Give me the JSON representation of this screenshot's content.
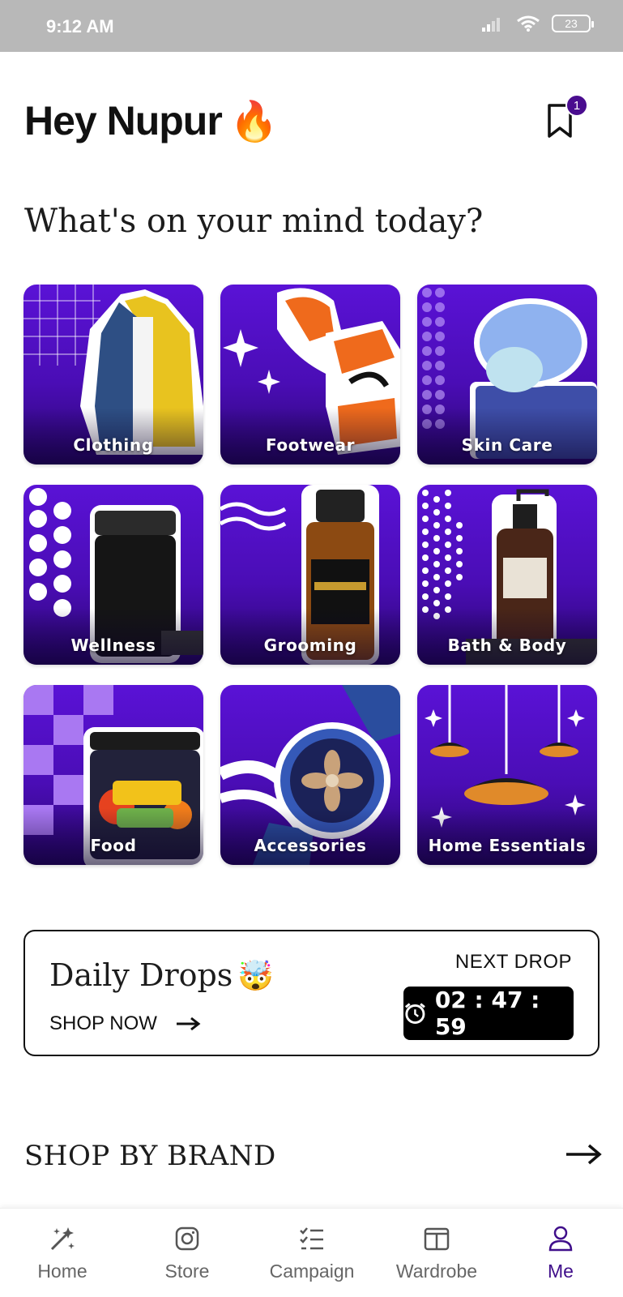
{
  "status_bar": {
    "time": "9:12 AM",
    "battery": "23",
    "icons": [
      "signal-icon",
      "wifi-icon",
      "battery-icon"
    ]
  },
  "header": {
    "greeting": "Hey Nupur",
    "greeting_emoji": "🔥",
    "bookmark_count": "1"
  },
  "prompt": "What's on your mind today?",
  "categories": [
    {
      "label": "Clothing"
    },
    {
      "label": "Footwear"
    },
    {
      "label": "Skin Care"
    },
    {
      "label": "Wellness"
    },
    {
      "label": "Grooming"
    },
    {
      "label": "Bath & Body"
    },
    {
      "label": "Food"
    },
    {
      "label": "Accessories"
    },
    {
      "label": "Home Essentials"
    }
  ],
  "daily_drops": {
    "title": "Daily Drops",
    "emoji": "🤯",
    "cta": "SHOP NOW",
    "next_drop_label": "NEXT DROP",
    "timer": "02 : 47 : 59"
  },
  "shop_by_brand": {
    "heading": "SHOP BY BRAND"
  },
  "bottom_nav": {
    "items": [
      {
        "label": "Home",
        "icon": "magic-wand-icon"
      },
      {
        "label": "Store",
        "icon": "instagram-icon"
      },
      {
        "label": "Campaign",
        "icon": "checklist-icon"
      },
      {
        "label": "Wardrobe",
        "icon": "wardrobe-icon"
      },
      {
        "label": "Me",
        "icon": "user-icon"
      }
    ],
    "active": "Me"
  },
  "colors": {
    "accent": "#3f0e8a",
    "tile_purple": "#5a12d6",
    "status_bar": "#b8b8b8"
  }
}
